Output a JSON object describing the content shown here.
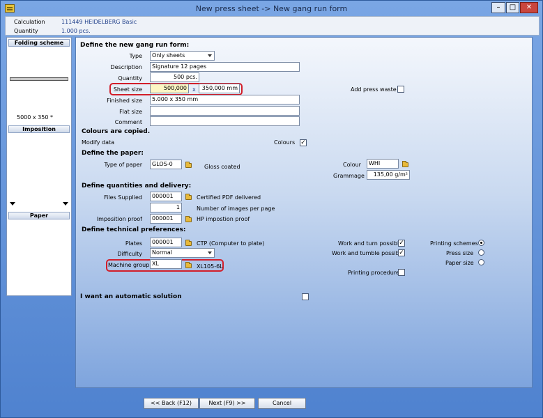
{
  "window": {
    "title": "New press sheet -> New gang run form",
    "minimize": "–",
    "maximize": "□",
    "close": "✕"
  },
  "info": {
    "calc_label": "Calculation",
    "calc_value": "111449 HEIDELBERG Basic",
    "qty_label": "Quantity",
    "qty_value": "1.000 pcs."
  },
  "left": {
    "folding": "Folding scheme",
    "folding_size": "5000 x 350 *",
    "imposition": "Imposition",
    "paper": "Paper"
  },
  "form": {
    "heading": "Define the new gang run form:",
    "type_label": "Type",
    "type_value": "Only sheets",
    "desc_label": "Description",
    "desc_value": "Signature 12 pages",
    "qty_label": "Quantity",
    "qty_value": "500 pcs.",
    "sheet_label": "Sheet size",
    "sheet_w": "500,000",
    "sheet_x": "x",
    "sheet_h": "350,000 mm",
    "add_waste": "Add press waste",
    "finished_label": "Finished size",
    "finished_value": "5.000 x 350 mm",
    "flat_label": "Flat size",
    "comment_label": "Comment"
  },
  "colours": {
    "heading": "Colours are copied.",
    "modify": "Modify data",
    "colours_label": "Colours"
  },
  "paper": {
    "heading": "Define the paper:",
    "type_label": "Type of paper",
    "type_value": "GLOS-0",
    "type_desc": "Gloss coated",
    "colour_label": "Colour",
    "colour_value": "WHI",
    "grammage_label": "Grammage",
    "grammage_value": "135,00 g/m²"
  },
  "delivery": {
    "heading": "Define quantities and delivery:",
    "files_label": "Files Supplied",
    "files_value": "000001",
    "files_desc": "Certified PDF delivered",
    "images_value": "1",
    "images_desc": "Number of images per page",
    "proof_label": "Imposition proof",
    "proof_value": "000001",
    "proof_desc": "HP impostion proof"
  },
  "tech": {
    "heading": "Define technical preferences:",
    "plates_label": "Plates",
    "plates_value": "000001",
    "plates_desc": "CTP (Computer to plate)",
    "difficulty_label": "Difficulty",
    "difficulty_value": "Normal",
    "machine_label": "Machine group",
    "machine_value": "XL",
    "machine_desc": "XL105-6L",
    "turn": "Work and turn possible",
    "tumble": "Work and tumble possible",
    "procedure": "Printing procedure",
    "schemes": "Printing schemes",
    "press_size": "Press size",
    "paper_size": "Paper size"
  },
  "auto": {
    "label": "I want an automatic solution"
  },
  "buttons": {
    "back": "<< Back (F12)",
    "next": "Next (F9) >>",
    "cancel": "Cancel"
  },
  "checkmark": "✓"
}
